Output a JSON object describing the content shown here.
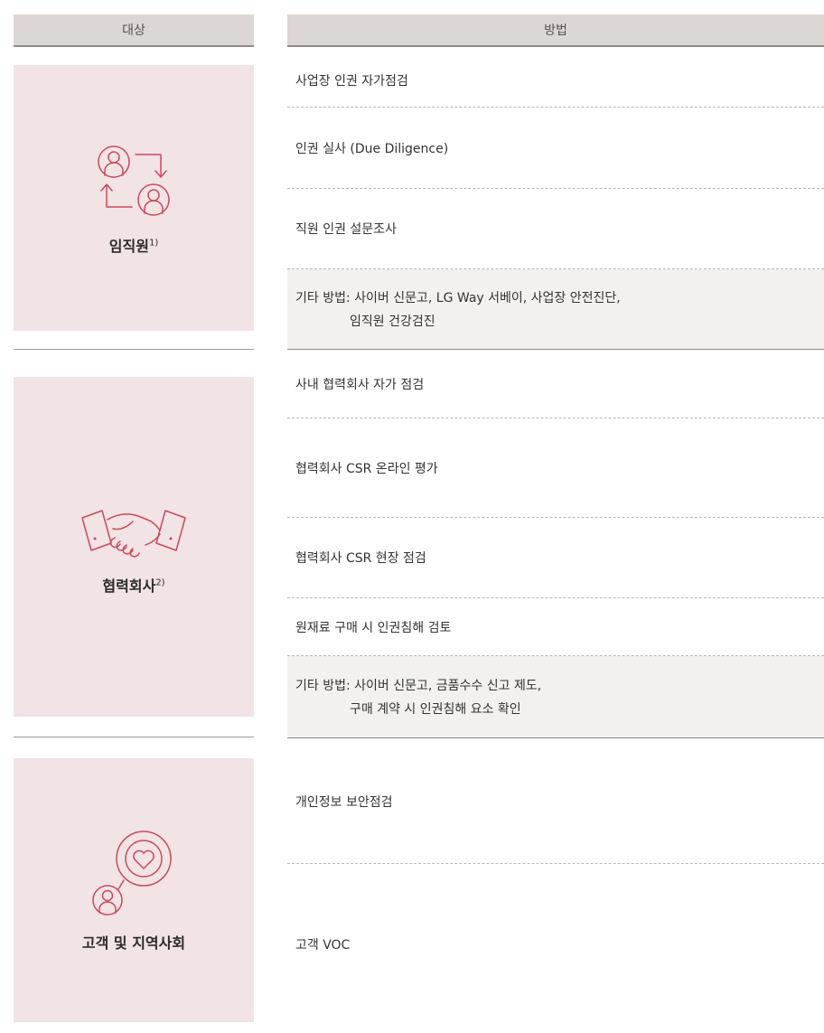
{
  "header": {
    "target": "대상",
    "method": "방법"
  },
  "groups": [
    {
      "label": "임직원",
      "sup": "1)",
      "icon": "employees-exchange-icon",
      "methods": [
        "사업장 인권 자가점검",
        "인권 실사 (Due Diligence)",
        "직원 인권 설문조사"
      ],
      "other": {
        "line1": "기타 방법: 사이버 신문고, LG Way 서베이, 사업장 안전진단,",
        "line2": "임직원 건강검진"
      }
    },
    {
      "label": "협력회사",
      "sup": "2)",
      "icon": "handshake-icon",
      "methods": [
        "사내 협력회사 자가 점검",
        "협력회사 CSR 온라인 평가",
        "협력회사 CSR 현장 점검",
        "원재료 구매 시 인권침해 검토"
      ],
      "other": {
        "line1": "기타 방법: 사이버 신문고, 금품수수 신고 제도,",
        "line2": "구매 계약 시 인권침해 요소 확인"
      }
    },
    {
      "label": "고객 및 지역사회",
      "icon": "customer-heart-icon",
      "methods": [
        "개인정보 보안점검",
        "고객 VOC"
      ]
    }
  ],
  "colors": {
    "accent": "#c94a5a",
    "target_bg": "#f2e3e5",
    "header_bg": "#dcd6d4",
    "other_bg": "#f2f1f0"
  }
}
